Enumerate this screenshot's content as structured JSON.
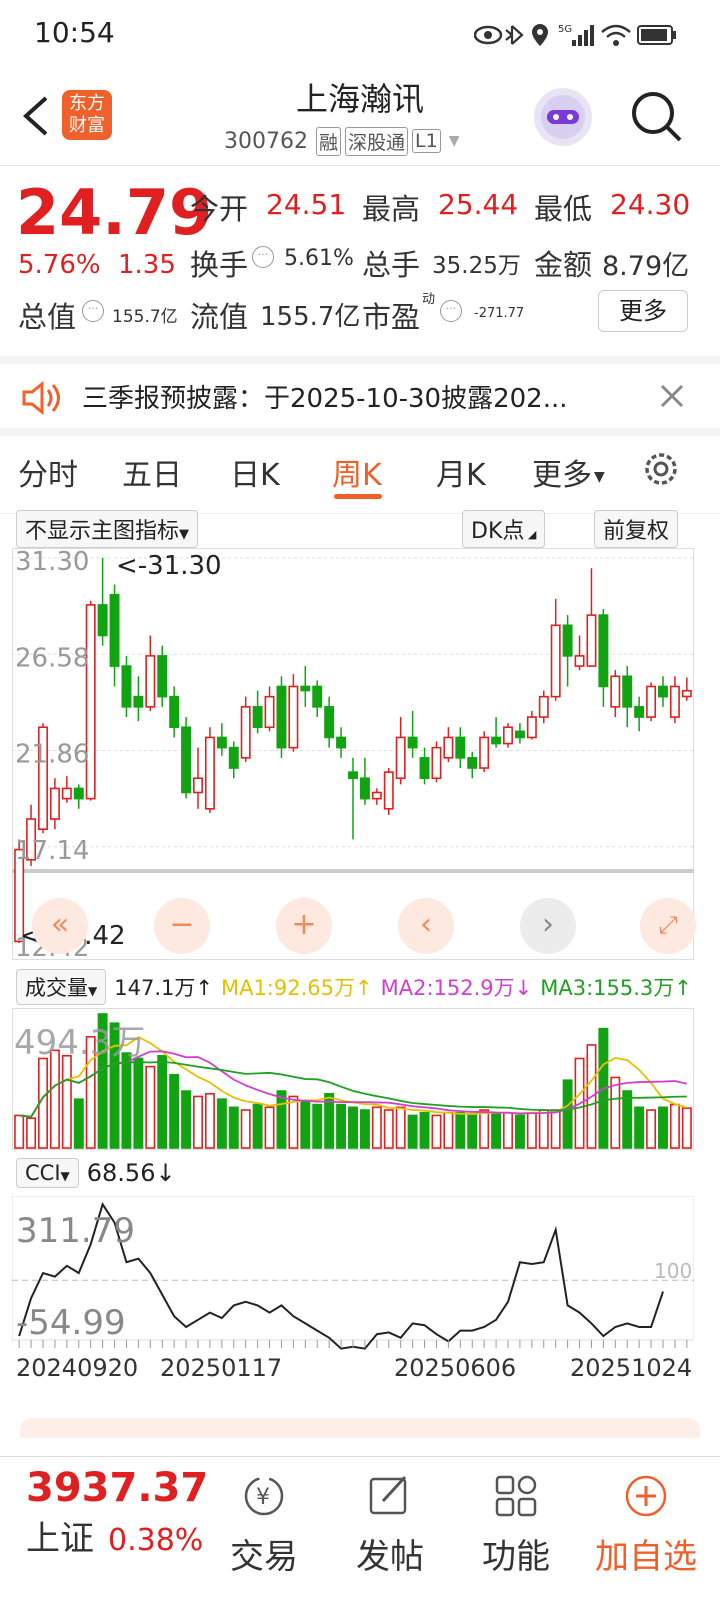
{
  "status_bar": {
    "time": "10:54",
    "network": "5G"
  },
  "header": {
    "back_icon": "chevron-left-icon",
    "app_logo_text": "东方财富",
    "title": "上海瀚讯",
    "code": "300762",
    "tags": [
      "融",
      "深股通",
      "L1"
    ],
    "search_icon": "search-icon"
  },
  "quote": {
    "price": "24.79",
    "pct": "5.76%",
    "change": "1.35",
    "open_label": "今开",
    "open": "24.51",
    "high_label": "最高",
    "high": "25.44",
    "low_label": "最低",
    "low": "24.30",
    "turnover_label": "换手",
    "turnover": "5.61%",
    "volume_label": "总手",
    "volume": "35.25万",
    "amount_label": "金额",
    "amount": "8.79亿",
    "mktcap_label": "总值",
    "mktcap": "155.7亿",
    "float_label": "流值",
    "float": "155.7亿",
    "pe_label": "市盈",
    "pe_sup": "动",
    "pe": "-271.77",
    "more_button": "更多"
  },
  "notice": {
    "text": "三季报预披露：于2025-10-30披露202...",
    "close_icon": "close-icon"
  },
  "tabs": [
    "分时",
    "五日",
    "日K",
    "周K",
    "月K",
    "更多"
  ],
  "active_tab": "周K",
  "chart_controls": {
    "indicator_select": "不显示主图指标",
    "dk_button": "DK点",
    "fq_button": "前复权"
  },
  "volume_header": {
    "select": "成交量",
    "current": "147.1万↑",
    "ma1": "MA1:92.65万↑",
    "ma2": "MA2:152.9万↓",
    "ma3": "MA3:155.3万↑"
  },
  "cci_header": {
    "select": "CCI",
    "value": "68.56↓"
  },
  "bottom_bar": {
    "index_value": "3937.37",
    "index_name": "上证",
    "index_pct": "0.38%",
    "items": [
      "交易",
      "发帖",
      "功能",
      "加自选"
    ]
  },
  "colors": {
    "up": "#e02020",
    "down": "#12a312",
    "accent": "#f0602a",
    "ma1": "#e6c000",
    "ma2": "#d040d0",
    "ma3": "#22a022"
  },
  "chart_data": [
    {
      "type": "candlestick",
      "price_axis_labels": [
        "31.30",
        "26.58",
        "21.86",
        "17.14",
        "12.42"
      ],
      "ylim": [
        12.42,
        31.3
      ],
      "max_marker": "<-31.30",
      "min_marker": "<-12.42",
      "x_labels": [
        "20240920",
        "20250117",
        "20250606",
        "20251024"
      ],
      "candles": [
        {
          "o": 12.5,
          "c": 17.0,
          "h": 17.5,
          "l": 12.42
        },
        {
          "o": 16.5,
          "c": 18.5,
          "h": 19.2,
          "l": 16.2
        },
        {
          "o": 18.0,
          "c": 23.0,
          "h": 23.2,
          "l": 17.8
        },
        {
          "o": 18.5,
          "c": 20.0,
          "h": 20.5,
          "l": 18.0
        },
        {
          "o": 19.5,
          "c": 20.0,
          "h": 20.6,
          "l": 19.3
        },
        {
          "o": 20.0,
          "c": 19.5,
          "h": 20.2,
          "l": 19.0
        },
        {
          "o": 19.5,
          "c": 29.0,
          "h": 29.2,
          "l": 19.4
        },
        {
          "o": 29.0,
          "c": 27.5,
          "h": 31.3,
          "l": 27.0
        },
        {
          "o": 29.5,
          "c": 26.0,
          "h": 30.0,
          "l": 25.0
        },
        {
          "o": 26.0,
          "c": 24.0,
          "h": 26.5,
          "l": 23.5
        },
        {
          "o": 24.5,
          "c": 24.0,
          "h": 25.5,
          "l": 23.3
        },
        {
          "o": 24.0,
          "c": 26.5,
          "h": 27.5,
          "l": 23.8
        },
        {
          "o": 26.5,
          "c": 24.5,
          "h": 27.0,
          "l": 24.0
        },
        {
          "o": 24.5,
          "c": 23.0,
          "h": 25.0,
          "l": 22.5
        },
        {
          "o": 23.0,
          "c": 19.8,
          "h": 23.5,
          "l": 19.5
        },
        {
          "o": 19.8,
          "c": 20.5,
          "h": 22.0,
          "l": 19.0
        },
        {
          "o": 19.0,
          "c": 22.5,
          "h": 23.0,
          "l": 18.8
        },
        {
          "o": 22.5,
          "c": 22.0,
          "h": 23.2,
          "l": 21.6
        },
        {
          "o": 22.0,
          "c": 21.0,
          "h": 22.3,
          "l": 20.5
        },
        {
          "o": 21.5,
          "c": 24.0,
          "h": 24.5,
          "l": 21.3
        },
        {
          "o": 24.0,
          "c": 23.0,
          "h": 24.8,
          "l": 22.7
        },
        {
          "o": 23.0,
          "c": 24.5,
          "h": 25.0,
          "l": 22.8
        },
        {
          "o": 25.0,
          "c": 22.0,
          "h": 25.5,
          "l": 21.5
        },
        {
          "o": 22.0,
          "c": 25.0,
          "h": 25.6,
          "l": 21.8
        },
        {
          "o": 25.0,
          "c": 24.8,
          "h": 26.0,
          "l": 24.0
        },
        {
          "o": 25.0,
          "c": 24.0,
          "h": 25.3,
          "l": 23.5
        },
        {
          "o": 24.0,
          "c": 22.5,
          "h": 24.5,
          "l": 22.0
        },
        {
          "o": 22.5,
          "c": 22.0,
          "h": 23.0,
          "l": 21.5
        },
        {
          "o": 20.8,
          "c": 20.5,
          "h": 21.5,
          "l": 17.5
        },
        {
          "o": 20.5,
          "c": 19.5,
          "h": 21.5,
          "l": 19.2
        },
        {
          "o": 19.5,
          "c": 19.8,
          "h": 20.0,
          "l": 19.2
        },
        {
          "o": 19.0,
          "c": 20.8,
          "h": 21.0,
          "l": 18.7
        },
        {
          "o": 20.5,
          "c": 22.5,
          "h": 23.5,
          "l": 20.2
        },
        {
          "o": 22.5,
          "c": 22.0,
          "h": 23.8,
          "l": 21.5
        },
        {
          "o": 21.5,
          "c": 20.5,
          "h": 22.0,
          "l": 20.2
        },
        {
          "o": 20.5,
          "c": 22.0,
          "h": 22.3,
          "l": 20.3
        },
        {
          "o": 21.5,
          "c": 22.5,
          "h": 23.0,
          "l": 21.3
        },
        {
          "o": 22.5,
          "c": 21.5,
          "h": 23.0,
          "l": 21.0
        },
        {
          "o": 21.5,
          "c": 21.0,
          "h": 21.8,
          "l": 20.5
        },
        {
          "o": 21.0,
          "c": 22.5,
          "h": 22.8,
          "l": 20.8
        },
        {
          "o": 22.5,
          "c": 22.2,
          "h": 23.5,
          "l": 22.0
        },
        {
          "o": 22.2,
          "c": 23.0,
          "h": 23.2,
          "l": 22.0
        },
        {
          "o": 22.8,
          "c": 22.5,
          "h": 23.2,
          "l": 22.2
        },
        {
          "o": 22.5,
          "c": 23.5,
          "h": 23.8,
          "l": 22.4
        },
        {
          "o": 23.5,
          "c": 24.5,
          "h": 24.8,
          "l": 23.2
        },
        {
          "o": 24.5,
          "c": 28.0,
          "h": 29.3,
          "l": 24.3
        },
        {
          "o": 28.0,
          "c": 26.5,
          "h": 28.5,
          "l": 25.0
        },
        {
          "o": 26.0,
          "c": 26.5,
          "h": 27.5,
          "l": 25.8
        },
        {
          "o": 26.0,
          "c": 28.5,
          "h": 30.8,
          "l": 26.0
        },
        {
          "o": 28.5,
          "c": 25.0,
          "h": 28.8,
          "l": 24.0
        },
        {
          "o": 24.0,
          "c": 25.5,
          "h": 25.8,
          "l": 23.5
        },
        {
          "o": 25.5,
          "c": 24.0,
          "h": 26.0,
          "l": 23.0
        },
        {
          "o": 24.0,
          "c": 23.5,
          "h": 24.5,
          "l": 22.8
        },
        {
          "o": 23.5,
          "c": 25.0,
          "h": 25.2,
          "l": 23.3
        },
        {
          "o": 25.0,
          "c": 24.5,
          "h": 25.5,
          "l": 24.0
        },
        {
          "o": 23.5,
          "c": 25.0,
          "h": 25.5,
          "l": 23.2
        },
        {
          "o": 24.51,
          "c": 24.79,
          "h": 25.44,
          "l": 24.3
        }
      ],
      "volume_axis_label": "494.3万",
      "volumes": [
        120,
        110,
        330,
        360,
        340,
        180,
        410,
        494,
        460,
        350,
        330,
        300,
        340,
        270,
        210,
        190,
        200,
        180,
        150,
        140,
        160,
        150,
        210,
        190,
        170,
        160,
        200,
        160,
        150,
        140,
        150,
        140,
        150,
        120,
        130,
        120,
        130,
        130,
        120,
        140,
        130,
        130,
        120,
        130,
        140,
        140,
        250,
        330,
        380,
        440,
        260,
        210,
        150,
        140,
        150,
        160,
        147
      ],
      "cci_axis_labels": [
        "311.79",
        "-54.99",
        "100"
      ],
      "cci": [
        -55,
        50,
        120,
        110,
        140,
        120,
        200,
        311,
        260,
        150,
        160,
        120,
        60,
        0,
        -30,
        -10,
        10,
        -5,
        30,
        40,
        30,
        10,
        30,
        0,
        -20,
        -40,
        -60,
        -90,
        -85,
        -90,
        -50,
        -45,
        -60,
        -20,
        -25,
        -50,
        -70,
        -40,
        -40,
        -30,
        -10,
        40,
        150,
        145,
        150,
        240,
        30,
        10,
        -20,
        -55,
        -30,
        -20,
        -30,
        -30,
        68.56
      ]
    }
  ]
}
